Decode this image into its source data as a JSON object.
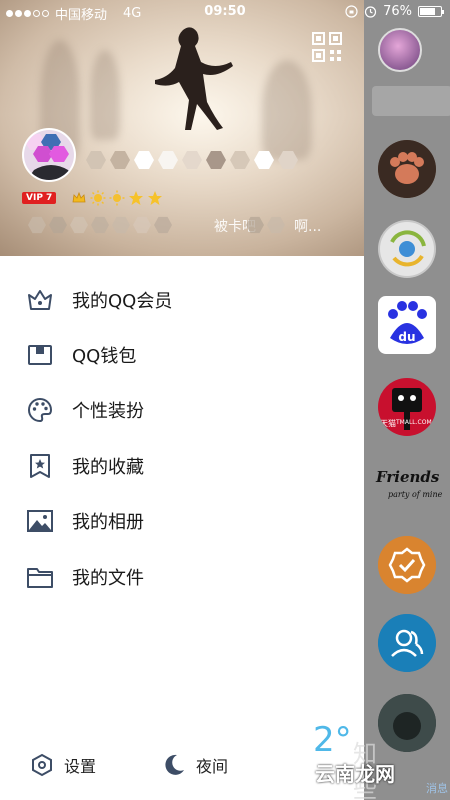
{
  "status_bar": {
    "carrier": "中国移动",
    "network": "4G",
    "time": "09:50",
    "battery": "76%",
    "battery_level": 0.76
  },
  "profile": {
    "vip_label": "VIP 7",
    "signature_visible_1": "被卡吧",
    "signature_visible_2": "啊...",
    "level_icons": [
      "crown-icon",
      "sun-icon",
      "sun-icon",
      "star-icon",
      "star-icon"
    ]
  },
  "menu": [
    {
      "label": "我的QQ会员",
      "icon": "crown-icon"
    },
    {
      "label": "QQ钱包",
      "icon": "wallet-icon"
    },
    {
      "label": "个性装扮",
      "icon": "palette-icon"
    },
    {
      "label": "我的收藏",
      "icon": "bookmark-star-icon"
    },
    {
      "label": "我的相册",
      "icon": "photo-icon"
    },
    {
      "label": "我的文件",
      "icon": "folder-icon"
    }
  ],
  "bottom": {
    "settings_label": "设置",
    "night_label": "夜间"
  },
  "right_panel": {
    "app_label": "天猫",
    "app_label_en": "TMALL.COM",
    "friends_label": "Friends",
    "friends_sub": "party of mine",
    "bottom_tab": "消息"
  },
  "weather": {
    "temperature": "2°"
  },
  "watermark": {
    "site": "云南龙网",
    "logo": "知些家"
  },
  "colors": {
    "accent_blue": "#4fb8e8",
    "vip_red": "#e02020",
    "menu_icon": "#3d4d66"
  }
}
